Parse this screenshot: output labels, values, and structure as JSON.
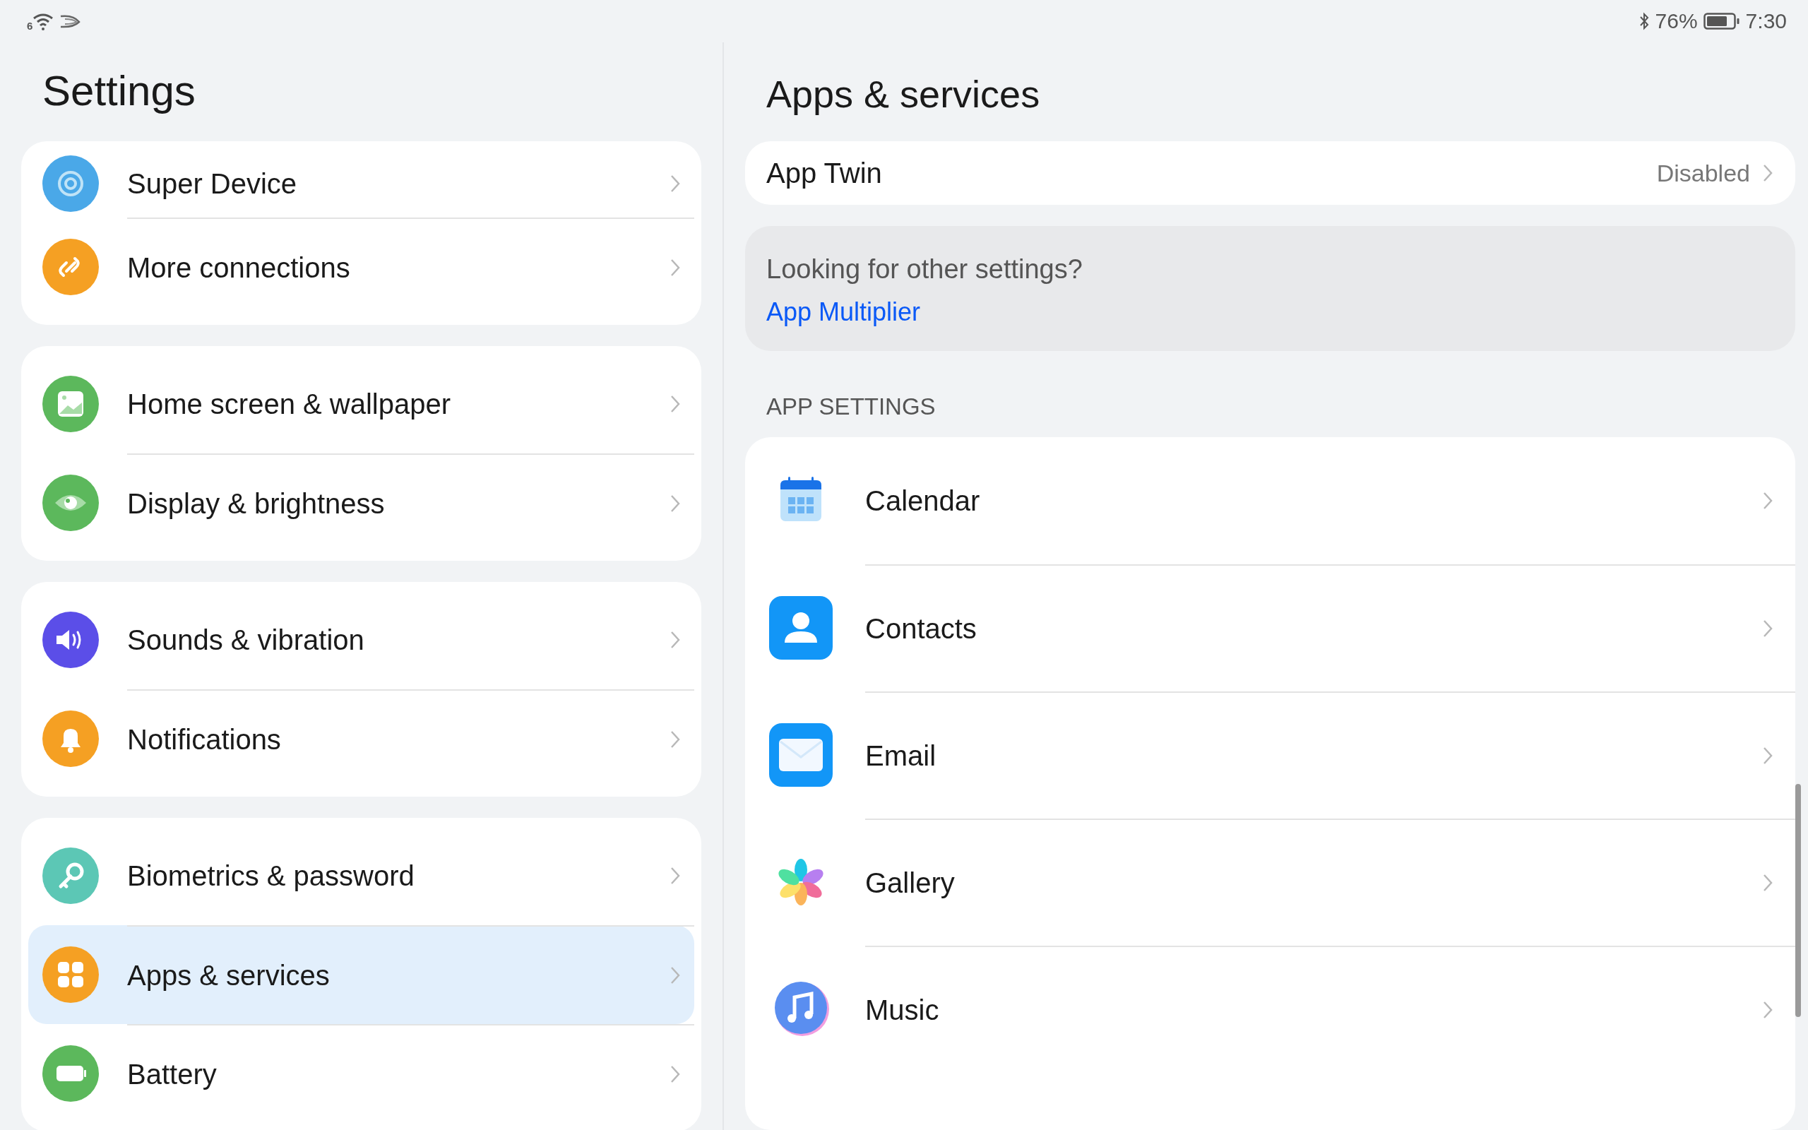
{
  "status_bar": {
    "wifi_badge": "6",
    "battery_percent": "76%",
    "time": "7:30"
  },
  "sidebar": {
    "title": "Settings",
    "groups": [
      {
        "items": [
          {
            "label": "Super Device",
            "selected": false
          },
          {
            "label": "More connections",
            "selected": false
          }
        ]
      },
      {
        "items": [
          {
            "label": "Home screen & wallpaper",
            "selected": false
          },
          {
            "label": "Display & brightness",
            "selected": false
          }
        ]
      },
      {
        "items": [
          {
            "label": "Sounds & vibration",
            "selected": false
          },
          {
            "label": "Notifications",
            "selected": false
          }
        ]
      },
      {
        "items": [
          {
            "label": "Biometrics & password",
            "selected": false
          },
          {
            "label": "Apps & services",
            "selected": true
          },
          {
            "label": "Battery",
            "selected": false
          }
        ]
      }
    ]
  },
  "detail": {
    "title": "Apps & services",
    "top_row": {
      "label": "App Twin",
      "value": "Disabled"
    },
    "info_card": {
      "text": "Looking for other settings?",
      "link": "App Multiplier"
    },
    "section_header": "APP SETTINGS",
    "apps": [
      {
        "label": "Calendar"
      },
      {
        "label": "Contacts"
      },
      {
        "label": "Email"
      },
      {
        "label": "Gallery"
      },
      {
        "label": "Music"
      }
    ]
  }
}
